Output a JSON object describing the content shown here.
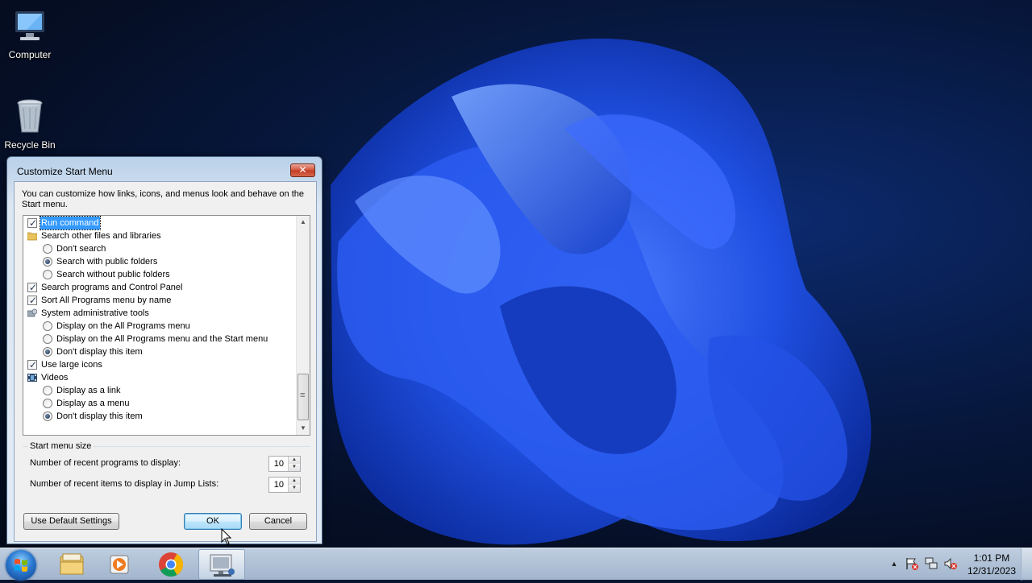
{
  "desktop": {
    "icons": [
      {
        "label": "Computer",
        "icon": "computer-icon"
      },
      {
        "label": "Recycle Bin",
        "icon": "recycle-bin-icon"
      }
    ]
  },
  "dialog": {
    "title": "Customize Start Menu",
    "close_glyph": "✕",
    "intro": "You can customize how links, icons, and menus look and behave on the Start menu.",
    "options": [
      {
        "type": "checkbox",
        "checked": true,
        "selected": true,
        "label": "Run command"
      },
      {
        "type": "folder",
        "label": "Search other files and libraries"
      },
      {
        "type": "radio",
        "checked": false,
        "label": "Don't search"
      },
      {
        "type": "radio",
        "checked": true,
        "label": "Search with public folders"
      },
      {
        "type": "radio",
        "checked": false,
        "label": "Search without public folders"
      },
      {
        "type": "checkbox",
        "checked": true,
        "label": "Search programs and Control Panel"
      },
      {
        "type": "checkbox",
        "checked": true,
        "label": "Sort All Programs menu by name"
      },
      {
        "type": "tools",
        "label": "System administrative tools"
      },
      {
        "type": "radio",
        "checked": false,
        "label": "Display on the All Programs menu"
      },
      {
        "type": "radio",
        "checked": false,
        "label": "Display on the All Programs menu and the Start menu"
      },
      {
        "type": "radio",
        "checked": true,
        "label": "Don't display this item"
      },
      {
        "type": "checkbox",
        "checked": true,
        "label": "Use large icons"
      },
      {
        "type": "video",
        "label": "Videos"
      },
      {
        "type": "radio",
        "checked": false,
        "label": "Display as a link"
      },
      {
        "type": "radio",
        "checked": false,
        "label": "Display as a menu"
      },
      {
        "type": "radio",
        "checked": true,
        "label": "Don't display this item"
      }
    ],
    "start_menu_size": {
      "legend": "Start menu size",
      "recent_programs_label": "Number of recent programs to display:",
      "recent_programs_value": "10",
      "jump_list_label": "Number of recent items to display in Jump Lists:",
      "jump_list_value": "10"
    },
    "buttons": {
      "default_settings": "Use Default Settings",
      "ok": "OK",
      "cancel": "Cancel"
    }
  },
  "taskbar": {
    "pinned": [
      "start-orb",
      "windows-explorer-icon",
      "media-player-icon",
      "chrome-icon",
      "control-panel-icon"
    ],
    "tray": [
      "show-hidden-icons-arrow",
      "action-center-icon",
      "network-icon",
      "volume-muted-icon"
    ],
    "clock": {
      "time": "1:01 PM",
      "date": "12/31/2023"
    }
  }
}
